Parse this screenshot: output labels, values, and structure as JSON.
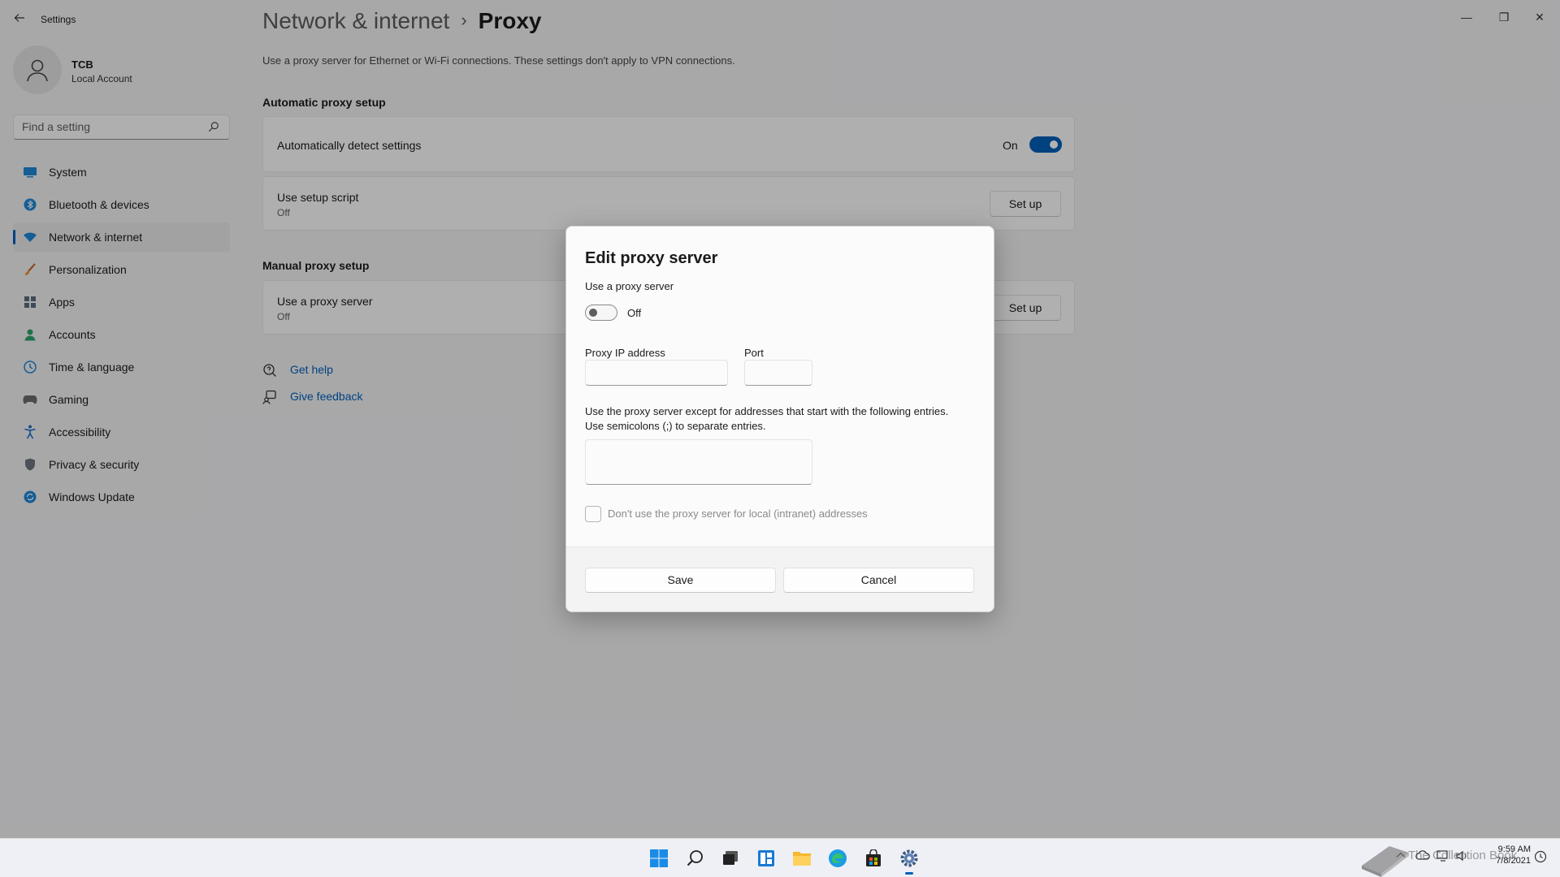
{
  "window": {
    "app_title": "Settings",
    "minimize": "—",
    "maximize": "❐",
    "close": "✕"
  },
  "profile": {
    "name": "TCB",
    "account_type": "Local Account"
  },
  "search": {
    "placeholder": "Find a setting"
  },
  "sidebar": {
    "items": [
      {
        "label": "System",
        "icon": "monitor-icon",
        "active": false
      },
      {
        "label": "Bluetooth & devices",
        "icon": "bluetooth-icon",
        "active": false
      },
      {
        "label": "Network & internet",
        "icon": "wifi-icon",
        "active": true
      },
      {
        "label": "Personalization",
        "icon": "brush-icon",
        "active": false
      },
      {
        "label": "Apps",
        "icon": "apps-icon",
        "active": false
      },
      {
        "label": "Accounts",
        "icon": "person-icon",
        "active": false
      },
      {
        "label": "Time & language",
        "icon": "globe-clock-icon",
        "active": false
      },
      {
        "label": "Gaming",
        "icon": "gamepad-icon",
        "active": false
      },
      {
        "label": "Accessibility",
        "icon": "accessibility-icon",
        "active": false
      },
      {
        "label": "Privacy & security",
        "icon": "shield-icon",
        "active": false
      },
      {
        "label": "Windows Update",
        "icon": "update-icon",
        "active": false
      }
    ]
  },
  "page": {
    "breadcrumb_parent": "Network & internet",
    "breadcrumb_separator": "›",
    "breadcrumb_current": "Proxy",
    "description": "Use a proxy server for Ethernet or Wi-Fi connections. These settings don't apply to VPN connections.",
    "automatic_section": "Automatic proxy setup",
    "auto_detect": {
      "title": "Automatically detect settings",
      "state": "On"
    },
    "setup_script": {
      "title": "Use setup script",
      "subtitle": "Off",
      "button": "Set up"
    },
    "manual_section": "Manual proxy setup",
    "use_proxy": {
      "title": "Use a proxy server",
      "subtitle": "Off",
      "button": "Set up"
    },
    "help": {
      "get_help": "Get help",
      "give_feedback": "Give feedback"
    }
  },
  "dialog": {
    "title": "Edit proxy server",
    "use_proxy_label": "Use a proxy server",
    "toggle_state": "Off",
    "ip_label": "Proxy IP address",
    "ip_value": "",
    "port_label": "Port",
    "port_value": "",
    "exceptions_line1": "Use the proxy server except for addresses that start with the following entries.",
    "exceptions_line2": "Use semicolons (;) to separate entries.",
    "exceptions_value": "",
    "local_checkbox_label": "Don't use the proxy server for local (intranet) addresses",
    "save_button": "Save",
    "cancel_button": "Cancel"
  },
  "taskbar": {
    "time": "9:59 AM",
    "date": "7/8/2021",
    "watermark": "The Collection Book"
  },
  "colors": {
    "accent": "#005fb8",
    "background": "#f1f1f3",
    "card": "#fbfbfb"
  }
}
